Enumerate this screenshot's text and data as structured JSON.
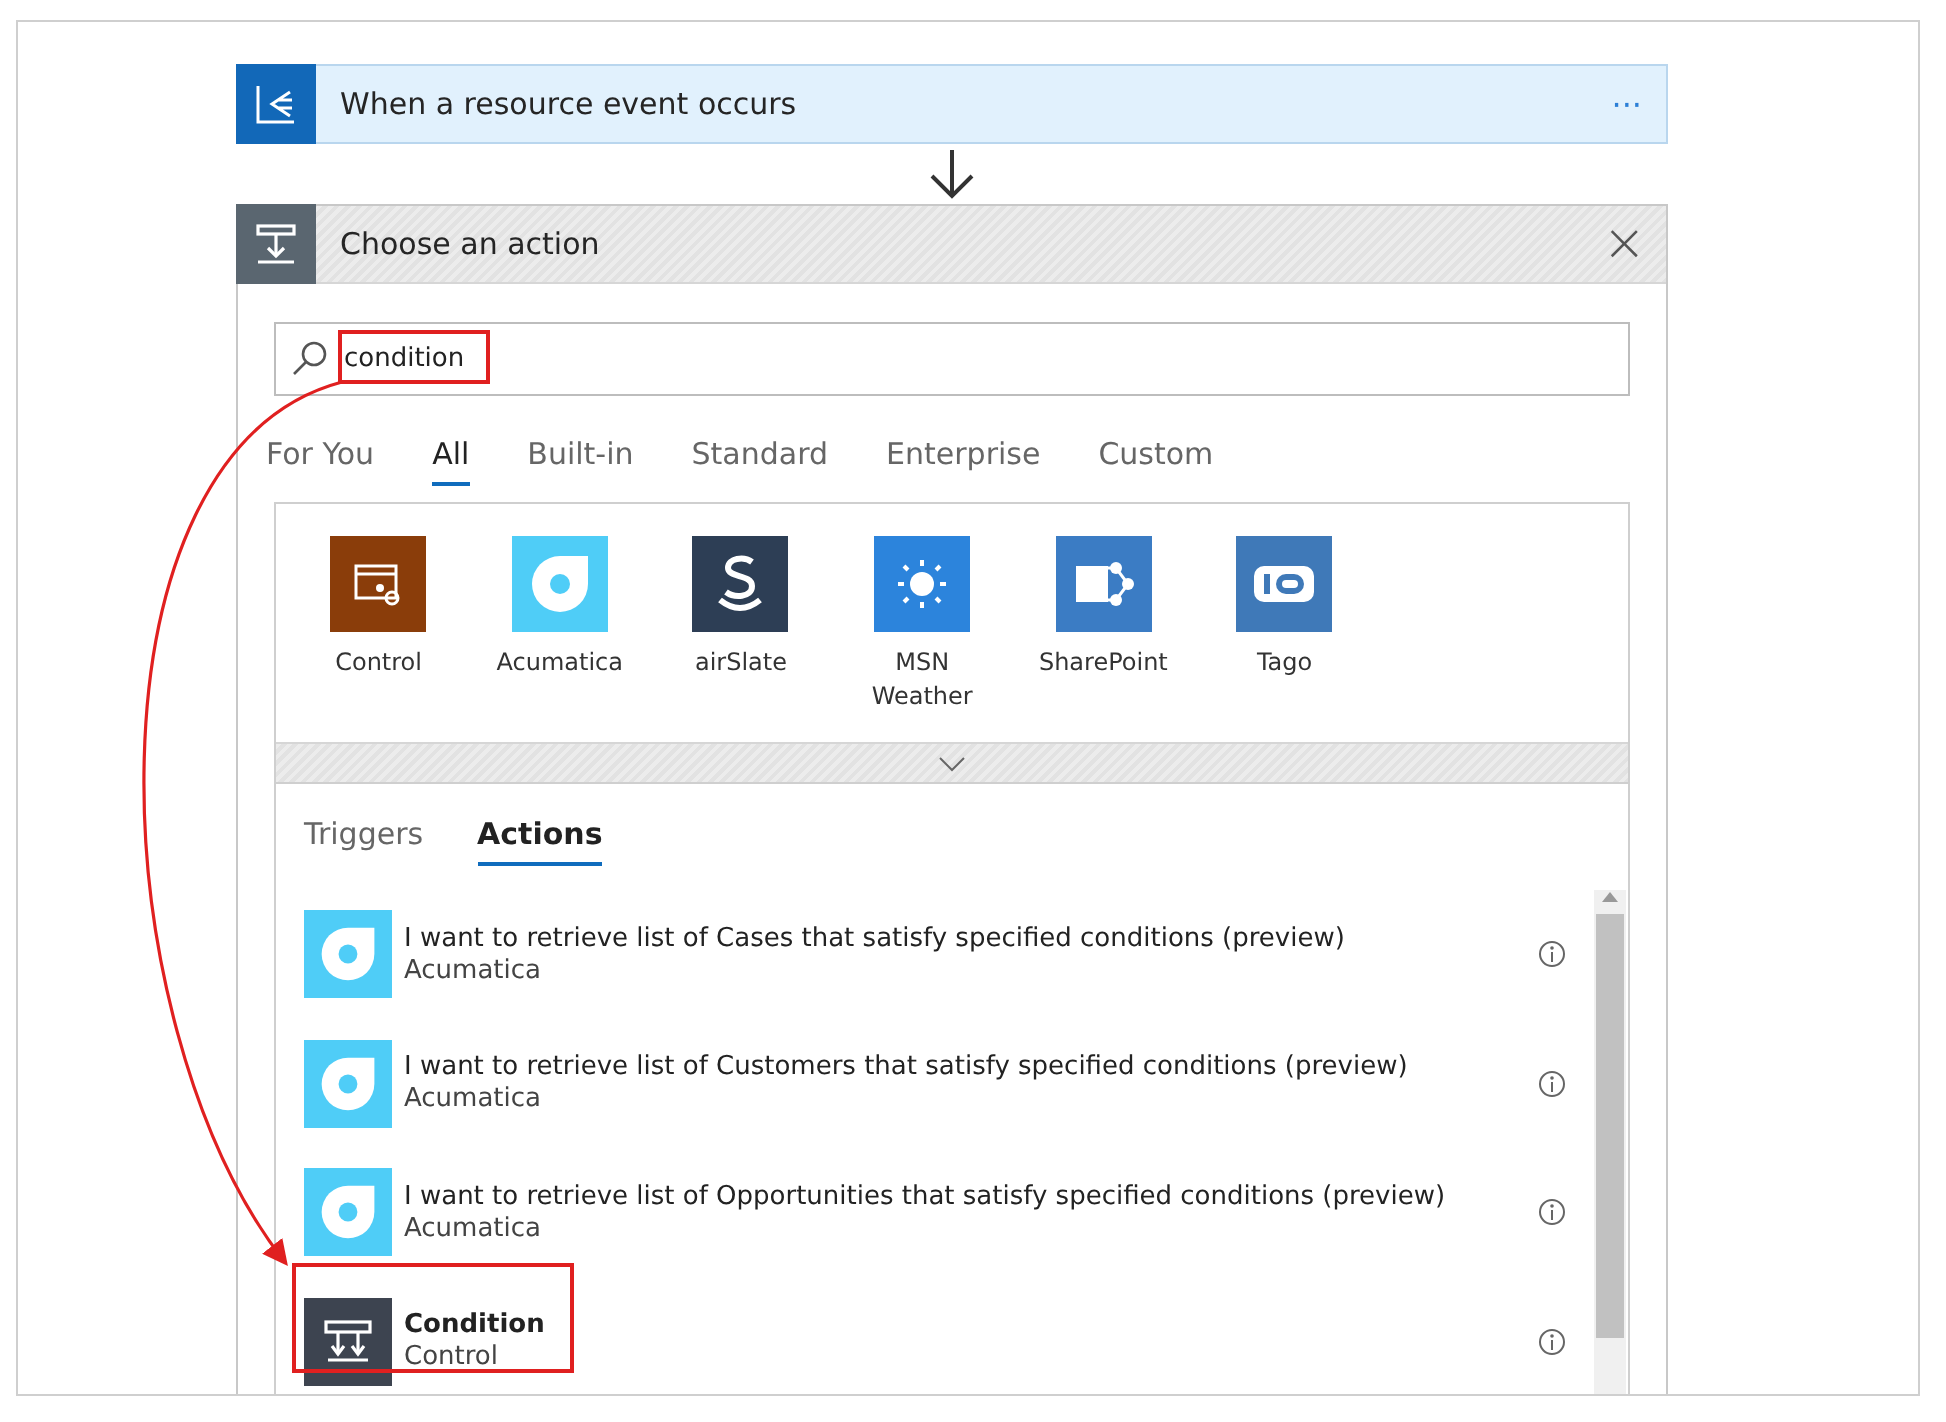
{
  "trigger": {
    "title": "When a resource event occurs",
    "menu": "···"
  },
  "action_picker": {
    "title": "Choose an action",
    "close": "×",
    "search": {
      "value": "condition",
      "highlighted": true
    },
    "tabs": [
      {
        "label": "For You",
        "selected": false
      },
      {
        "label": "All",
        "selected": true
      },
      {
        "label": "Built-in",
        "selected": false
      },
      {
        "label": "Standard",
        "selected": false
      },
      {
        "label": "Enterprise",
        "selected": false
      },
      {
        "label": "Custom",
        "selected": false
      }
    ],
    "connectors": [
      {
        "name": "Control",
        "color": "#8a3d0a"
      },
      {
        "name": "Acumatica",
        "color": "#4fcdf7"
      },
      {
        "name": "airSlate",
        "color": "#2d3e55"
      },
      {
        "name": "MSN Weather",
        "color": "#2c84dc"
      },
      {
        "name": "SharePoint",
        "color": "#3b7cc4"
      },
      {
        "name": "Tago",
        "color": "#3f79b8"
      }
    ],
    "subtabs": [
      {
        "label": "Triggers",
        "selected": false
      },
      {
        "label": "Actions",
        "selected": true
      }
    ],
    "actions": [
      {
        "kind": "connector",
        "title": "I want to retrieve list of Cases that satisfy specified conditions (preview)",
        "source": "Acumatica",
        "color": "#4fcdf7",
        "highlighted": false
      },
      {
        "kind": "connector",
        "title": "I want to retrieve list of Customers that satisfy specified conditions (preview)",
        "source": "Acumatica",
        "color": "#4fcdf7",
        "highlighted": false
      },
      {
        "kind": "connector",
        "title": "I want to retrieve list of Opportunities that satisfy specified conditions (preview)",
        "source": "Acumatica",
        "color": "#4fcdf7",
        "highlighted": false
      },
      {
        "kind": "builtin",
        "title": "Condition",
        "source": "Control",
        "color": "#3d4450",
        "highlighted": true
      }
    ]
  }
}
